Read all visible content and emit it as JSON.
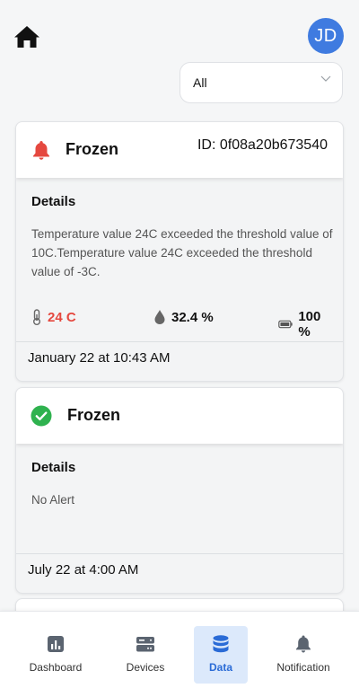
{
  "header": {
    "avatar_initials": "JD",
    "filter": {
      "selected": "All"
    }
  },
  "cards": [
    {
      "status": "alert",
      "title": "Frozen",
      "device_id": "ID: 0f08a20b673540",
      "details_title": "Details",
      "details_text": "Temperature value 24C exceeded the threshold value of 10C.Temperature value 24C exceeded the threshold value of -3C.",
      "metrics": {
        "temperature": "24 C",
        "humidity": "32.4 %",
        "battery": "100 %"
      },
      "timestamp": "January 22 at 10:43 AM"
    },
    {
      "status": "ok",
      "title": "Frozen",
      "details_title": "Details",
      "details_text": "No Alert",
      "timestamp": "July 22 at 4:00 AM"
    }
  ],
  "nav": {
    "items": [
      {
        "label": "Dashboard",
        "icon": "chart-icon"
      },
      {
        "label": "Devices",
        "icon": "server-icon"
      },
      {
        "label": "Data",
        "icon": "database-icon",
        "active": true
      },
      {
        "label": "Notification",
        "icon": "bell-icon"
      }
    ]
  },
  "colors": {
    "avatar": "#3f7be0",
    "alert": "#e5483f",
    "ok": "#2fb24f",
    "nav_active_bg": "#dce9fb",
    "nav_active_text": "#2a6bd6"
  }
}
